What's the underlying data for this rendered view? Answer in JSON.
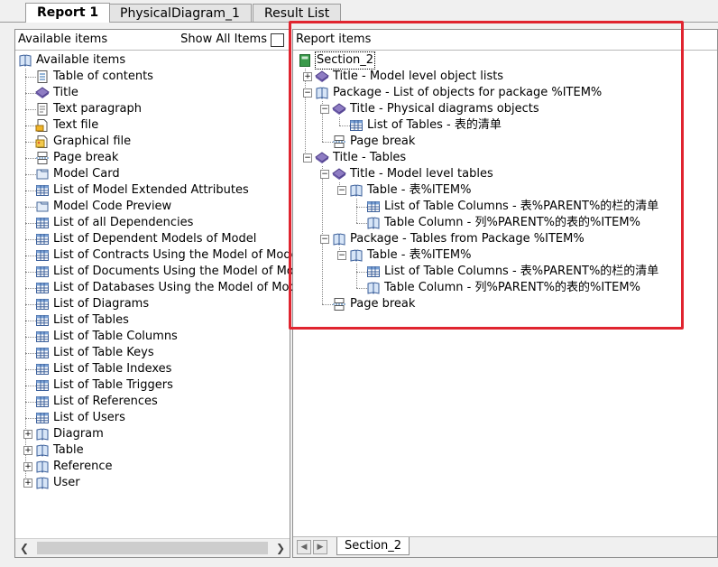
{
  "tabs": [
    {
      "label": "Report 1",
      "active": true
    },
    {
      "label": "PhysicalDiagram_1",
      "active": false
    },
    {
      "label": "Result List",
      "active": false
    }
  ],
  "left_panel": {
    "title": "Available items",
    "show_all_label": "Show All Items",
    "show_all_checked": false,
    "items": [
      {
        "label": "Available items",
        "icon": "book-icon",
        "depth": 0
      },
      {
        "label": "Table of contents",
        "icon": "toc-icon",
        "depth": 1
      },
      {
        "label": "Title",
        "icon": "title-icon",
        "depth": 1
      },
      {
        "label": "Text paragraph",
        "icon": "text-paragraph-icon",
        "depth": 1
      },
      {
        "label": "Text file",
        "icon": "text-file-icon",
        "depth": 1
      },
      {
        "label": "Graphical file",
        "icon": "graphical-file-icon",
        "depth": 1
      },
      {
        "label": "Page break",
        "icon": "page-break-icon",
        "depth": 1
      },
      {
        "label": "Model Card",
        "icon": "card-icon",
        "depth": 1
      },
      {
        "label": "List of Model Extended Attributes",
        "icon": "list-icon",
        "depth": 1
      },
      {
        "label": "Model Code Preview",
        "icon": "card-icon",
        "depth": 1
      },
      {
        "label": "List of all Dependencies",
        "icon": "list-icon",
        "depth": 1
      },
      {
        "label": "List of Dependent Models of Model",
        "icon": "list-icon",
        "depth": 1
      },
      {
        "label": "List of Contracts Using the Model of Model",
        "icon": "list-icon",
        "depth": 1
      },
      {
        "label": "List of Documents Using the Model of Model",
        "icon": "list-icon",
        "depth": 1
      },
      {
        "label": "List of Databases Using the Model of Model",
        "icon": "list-icon",
        "depth": 1
      },
      {
        "label": "List of Diagrams",
        "icon": "list-icon",
        "depth": 1
      },
      {
        "label": "List of Tables",
        "icon": "list-icon",
        "depth": 1
      },
      {
        "label": "List of Table Columns",
        "icon": "list-icon",
        "depth": 1
      },
      {
        "label": "List of Table Keys",
        "icon": "list-icon",
        "depth": 1
      },
      {
        "label": "List of Table Indexes",
        "icon": "list-icon",
        "depth": 1
      },
      {
        "label": "List of Table Triggers",
        "icon": "list-icon",
        "depth": 1
      },
      {
        "label": "List of References",
        "icon": "list-icon",
        "depth": 1
      },
      {
        "label": "List of Users",
        "icon": "list-icon",
        "depth": 1
      },
      {
        "label": "Diagram",
        "icon": "book-icon",
        "depth": 1,
        "expander": "+"
      },
      {
        "label": "Table",
        "icon": "book-icon",
        "depth": 1,
        "expander": "+"
      },
      {
        "label": "Reference",
        "icon": "book-icon",
        "depth": 1,
        "expander": "+"
      },
      {
        "label": "User",
        "icon": "book-icon",
        "depth": 1,
        "expander": "+"
      }
    ]
  },
  "right_panel": {
    "title": "Report items",
    "items": [
      {
        "label": "Section_2",
        "icon": "section-icon",
        "depth": 0,
        "selected": true
      },
      {
        "label": "Title - Model level object lists",
        "icon": "title-icon",
        "depth": 1,
        "expander": "+"
      },
      {
        "label": "Package - List of objects for package %ITEM%",
        "icon": "book-icon",
        "depth": 1,
        "expander": "-"
      },
      {
        "label": "Title - Physical diagrams objects",
        "icon": "title-icon",
        "depth": 2,
        "expander": "-"
      },
      {
        "label": "List of Tables - 表的清单",
        "icon": "list-icon",
        "depth": 3
      },
      {
        "label": "Page break",
        "icon": "page-break-icon",
        "depth": 2
      },
      {
        "label": "Title - Tables",
        "icon": "title-icon",
        "depth": 1,
        "expander": "-"
      },
      {
        "label": "Title - Model level tables",
        "icon": "title-icon",
        "depth": 2,
        "expander": "-"
      },
      {
        "label": "Table - 表%ITEM%",
        "icon": "book-icon",
        "depth": 3,
        "expander": "-"
      },
      {
        "label": "List of Table Columns - 表%PARENT%的栏的清单",
        "icon": "list-icon",
        "depth": 4
      },
      {
        "label": "Table Column - 列%PARENT%的表的%ITEM%",
        "icon": "book-icon",
        "depth": 4
      },
      {
        "label": "Package - Tables from Package %ITEM%",
        "icon": "book-icon",
        "depth": 2,
        "expander": "-"
      },
      {
        "label": "Table - 表%ITEM%",
        "icon": "book-icon",
        "depth": 3,
        "expander": "-"
      },
      {
        "label": "List of Table Columns - 表%PARENT%的栏的清单",
        "icon": "list-icon",
        "depth": 4
      },
      {
        "label": "Table Column - 列%PARENT%的表的%ITEM%",
        "icon": "book-icon",
        "depth": 4
      },
      {
        "label": "Page break",
        "icon": "page-break-icon",
        "depth": 2
      }
    ]
  },
  "bottom_tabs": [
    {
      "label": "Section_2"
    }
  ],
  "highlight_color": "#e0242f"
}
